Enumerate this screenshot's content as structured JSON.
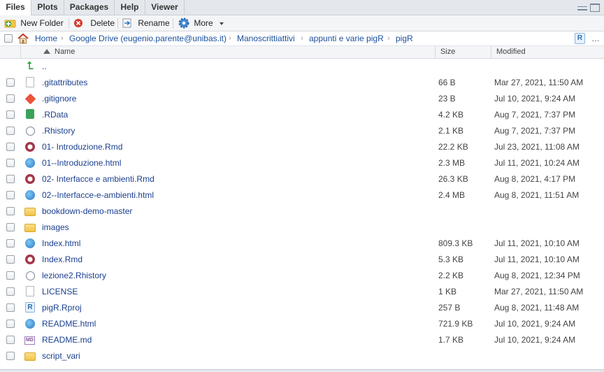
{
  "tabs": [
    {
      "label": "Files",
      "active": true
    },
    {
      "label": "Plots",
      "active": false
    },
    {
      "label": "Packages",
      "active": false
    },
    {
      "label": "Help",
      "active": false
    },
    {
      "label": "Viewer",
      "active": false
    }
  ],
  "toolbar": {
    "new_folder": "New Folder",
    "delete": "Delete",
    "rename": "Rename",
    "more": "More"
  },
  "breadcrumb": [
    "Home",
    "Google Drive (eugenio.parente@unibas.it)",
    "Manoscrittiattivi",
    "appunti e varie pigR",
    "pigR"
  ],
  "columns": {
    "name": "Name",
    "size": "Size",
    "modified": "Modified"
  },
  "parent_link": "..",
  "files": [
    {
      "name": ".gitattributes",
      "size": "66 B",
      "modified": "Mar 27, 2021, 11:50 AM",
      "icon": "document-icon"
    },
    {
      "name": ".gitignore",
      "size": "23 B",
      "modified": "Jul 10, 2021, 9:24 AM",
      "icon": "git-icon"
    },
    {
      "name": ".RData",
      "size": "4.2 KB",
      "modified": "Aug 7, 2021, 7:37 PM",
      "icon": "rdata-icon"
    },
    {
      "name": ".Rhistory",
      "size": "2.1 KB",
      "modified": "Aug 7, 2021, 7:37 PM",
      "icon": "history-icon"
    },
    {
      "name": "01- Introduzione.Rmd",
      "size": "22.2 KB",
      "modified": "Jul 23, 2021, 11:08 AM",
      "icon": "rmarkdown-icon"
    },
    {
      "name": "01--Introduzione.html",
      "size": "2.3 MB",
      "modified": "Jul 11, 2021, 10:24 AM",
      "icon": "html-globe-icon"
    },
    {
      "name": "02- Interfacce e ambienti.Rmd",
      "size": "26.3 KB",
      "modified": "Aug 8, 2021, 4:17 PM",
      "icon": "rmarkdown-icon"
    },
    {
      "name": "02--Interfacce-e-ambienti.html",
      "size": "2.4 MB",
      "modified": "Aug 8, 2021, 11:51 AM",
      "icon": "html-globe-icon"
    },
    {
      "name": "bookdown-demo-master",
      "size": "",
      "modified": "",
      "icon": "folder-icon"
    },
    {
      "name": "images",
      "size": "",
      "modified": "",
      "icon": "folder-icon"
    },
    {
      "name": "Index.html",
      "size": "809.3 KB",
      "modified": "Jul 11, 2021, 10:10 AM",
      "icon": "html-globe-icon"
    },
    {
      "name": "Index.Rmd",
      "size": "5.3 KB",
      "modified": "Jul 11, 2021, 10:10 AM",
      "icon": "rmarkdown-icon"
    },
    {
      "name": "lezione2.Rhistory",
      "size": "2.2 KB",
      "modified": "Aug 8, 2021, 12:34 PM",
      "icon": "history-icon"
    },
    {
      "name": "LICENSE",
      "size": "1 KB",
      "modified": "Mar 27, 2021, 11:50 AM",
      "icon": "document-icon"
    },
    {
      "name": "pigR.Rproj",
      "size": "257 B",
      "modified": "Aug 8, 2021, 11:48 AM",
      "icon": "rproject-icon"
    },
    {
      "name": "README.html",
      "size": "721.9 KB",
      "modified": "Jul 10, 2021, 9:24 AM",
      "icon": "html-globe-icon"
    },
    {
      "name": "README.md",
      "size": "1.7 KB",
      "modified": "Jul 10, 2021, 9:24 AM",
      "icon": "markdown-icon"
    },
    {
      "name": "script_vari",
      "size": "",
      "modified": "",
      "icon": "folder-icon"
    }
  ]
}
